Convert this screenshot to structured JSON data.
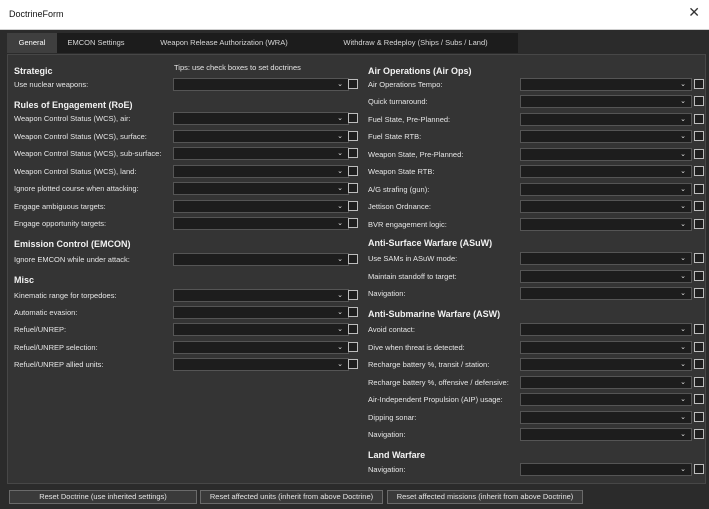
{
  "window": {
    "title": "DoctrineForm",
    "close_glyph": "✕"
  },
  "tabs": [
    {
      "label": "General"
    },
    {
      "label": "EMCON Settings"
    },
    {
      "label": "Weapon Release Authorization (WRA)"
    },
    {
      "label": "Withdraw & Redeploy (Ships / Subs / Land)"
    }
  ],
  "tips": "Tips: use check boxes to set doctrines",
  "left": {
    "strategic": {
      "title": "Strategic",
      "rows": [
        "Use nuclear weapons:"
      ]
    },
    "roe": {
      "title": "Rules of Engagement (RoE)",
      "rows": [
        "Weapon Control Status (WCS), air:",
        "Weapon Control Status (WCS), surface:",
        "Weapon Control Status (WCS), sub-surface:",
        "Weapon Control Status (WCS), land:",
        "Ignore plotted course when attacking:",
        "Engage ambiguous targets:",
        "Engage opportunity targets:"
      ]
    },
    "emcon": {
      "title": "Emission Control (EMCON)",
      "rows": [
        "Ignore EMCON while under attack:"
      ]
    },
    "misc": {
      "title": "Misc",
      "rows": [
        "Kinematic range for torpedoes:",
        "Automatic evasion:",
        "Refuel/UNREP:",
        "Refuel/UNREP selection:",
        "Refuel/UNREP allied units:"
      ]
    }
  },
  "right": {
    "air_ops": {
      "title": "Air Operations (Air Ops)",
      "rows": [
        "Air Operations Tempo:",
        "Quick turnaround:",
        "Fuel State, Pre-Planned:",
        "Fuel State RTB:",
        "Weapon State, Pre-Planned:",
        "Weapon State RTB:",
        "A/G strafing (gun):",
        "Jettison Ordnance:",
        "BVR engagement logic:"
      ]
    },
    "asuw": {
      "title": "Anti-Surface Warfare (ASuW)",
      "rows": [
        "Use SAMs in ASuW mode:",
        "Maintain standoff to target:",
        "Navigation:"
      ]
    },
    "asw": {
      "title": "Anti-Submarine Warfare (ASW)",
      "rows": [
        "Avoid contact:",
        "Dive when threat is detected:",
        "Recharge battery %, transit / station:",
        "Recharge battery %, offensive / defensive:",
        "Air-Independent Propulsion (AIP) usage:",
        "Dipping sonar:",
        "Navigation:"
      ]
    },
    "land": {
      "title": "Land Warfare",
      "rows": [
        "Navigation:"
      ]
    }
  },
  "dropdown_chevron": "⌄",
  "buttons": {
    "reset_doctrine": "Reset Doctrine (use inherited settings)",
    "reset_units": "Reset affected units (inherit from above Doctrine)",
    "reset_missions": "Reset affected missions (inherit from above Doctrine)"
  }
}
